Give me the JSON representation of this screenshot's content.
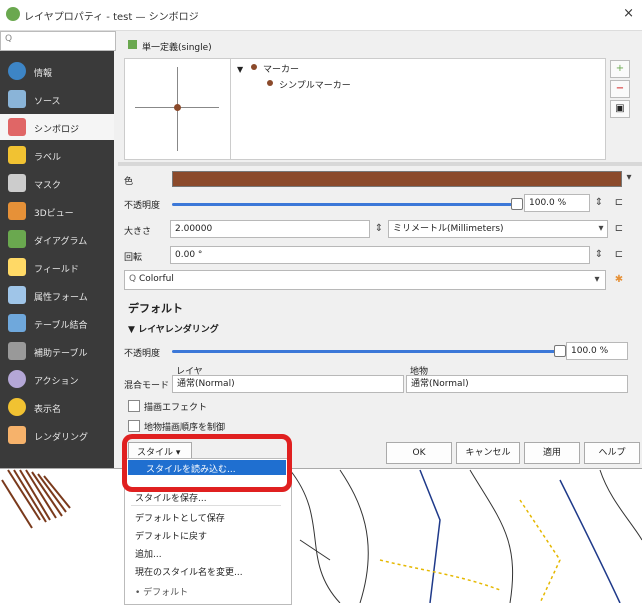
{
  "window": {
    "title": "レイヤプロパティ - test — シンボロジ",
    "close": "×"
  },
  "nav": {
    "search_placeholder": "Q",
    "items": [
      {
        "label": "情報",
        "icon": "info-icon",
        "color": "#3d85c6"
      },
      {
        "label": "ソース",
        "icon": "source-icon",
        "color": "#8ab4d8"
      },
      {
        "label": "シンボロジ",
        "icon": "symbology-icon",
        "color": "#e06666",
        "selected": true
      },
      {
        "label": "ラベル",
        "icon": "label-icon",
        "color": "#f1c232"
      },
      {
        "label": "マスク",
        "icon": "mask-icon",
        "color": "#cccccc"
      },
      {
        "label": "3Dビュー",
        "icon": "3d-view-icon",
        "color": "#e69138"
      },
      {
        "label": "ダイアグラム",
        "icon": "diagram-icon",
        "color": "#6aa84f"
      },
      {
        "label": "フィールド",
        "icon": "fields-icon",
        "color": "#ffd966"
      },
      {
        "label": "属性フォーム",
        "icon": "attribute-form-icon",
        "color": "#9fc5e8"
      },
      {
        "label": "テーブル結合",
        "icon": "join-icon",
        "color": "#6fa8dc"
      },
      {
        "label": "補助テーブル",
        "icon": "auxiliary-table-icon",
        "color": "#999999"
      },
      {
        "label": "アクション",
        "icon": "action-icon",
        "color": "#b4a7d6"
      },
      {
        "label": "表示名",
        "icon": "display-icon",
        "color": "#f1c232"
      },
      {
        "label": "レンダリング",
        "icon": "rendering-icon",
        "color": "#f6b26b"
      }
    ]
  },
  "renderer": {
    "value": "単一定義(single)"
  },
  "tree": {
    "marker": "マーカー",
    "simple_marker": "シンプルマーカー"
  },
  "symbol": {
    "color_label": "色",
    "color_value": "#8b4a2b",
    "opacity_label": "不透明度",
    "opacity_value": "100.0 %",
    "size_label": "大きさ",
    "size_value": "2.00000",
    "unit_value": "ミリメートル(Millimeters)",
    "rotation_label": "回転",
    "rotation_value": "0.00 °",
    "library_search": "Colorful"
  },
  "styles": {
    "default_heading": "デフォルト",
    "layer_rendering": "レイヤレンダリング",
    "opacity_label": "不透明度",
    "opacity_value": "100.0 %",
    "blend_label": "混合モード",
    "layer_sub": "レイヤ",
    "feature_sub": "地物",
    "layer_blend": "通常(Normal)",
    "feature_blend": "通常(Normal)",
    "draw_effects": "描画エフェクト",
    "control_order": "地物描画順序を制御"
  },
  "buttons": {
    "style": "スタイル",
    "ok": "OK",
    "cancel": "キャンセル",
    "apply": "適用",
    "help": "ヘルプ"
  },
  "style_menu": {
    "load": "スタイルを読み込む...",
    "save": "スタイルを保存...",
    "save_default": "デフォルトとして保存",
    "restore_default": "デフォルトに戻す",
    "add": "追加...",
    "rename": "現在のスタイル名を変更...",
    "current": "デフォルト"
  },
  "colors": {
    "highlight": "#1f6fd0",
    "annotation": "#e02020",
    "slider": "#3c78d8"
  }
}
